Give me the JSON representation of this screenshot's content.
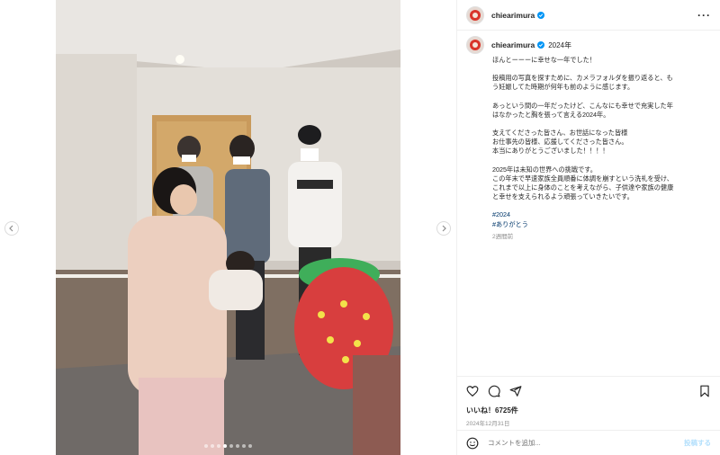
{
  "post": {
    "username": "chiearimura",
    "caption_year": "2024年",
    "caption_lines": [
      "ほんとーーーに幸せな一年でした！",
      "",
      "投稿用の写真を探すために、カメラフォルダを振り返ると、も\nう妊娠してた時期が何年も前のように感じます。",
      "",
      "あっという間の一年だったけど、こんなにも幸せで充実した年\nはなかったと胸を張って言える2024年。",
      "",
      "支えてくださった皆さん、お世話になった皆様\nお仕事先の皆様、応援してくださった皆さん。\n本当にありがとうございました！！！！",
      "",
      "2025年は未知の世界への挑戦です。\nこの年末で早速家族全員順番に体調を崩すという洗礼を受け、\nこれまで以上に身体のことを考えながら、子供達や家族の健康\nと幸せを支えられるよう頑張っていきたいです。"
    ],
    "hashtags": [
      "#2024",
      "#ありがとう"
    ],
    "time_ago": "2週間前",
    "likes": "いいね！6725件",
    "date": "2024年12月31日",
    "comment_placeholder": "コメントを追加...",
    "post_label": "投稿する",
    "carousel": {
      "count": 8,
      "active_index": 3
    }
  },
  "colors": {
    "verified": "#0095f6",
    "hashtag": "#00376b",
    "muted": "#8e8e8e",
    "post_button": "#b2dffc"
  },
  "icons": {
    "more": "more-icon",
    "like": "heart-icon",
    "comment": "comment-icon",
    "share": "share-icon",
    "save": "bookmark-icon",
    "emoji": "emoji-icon",
    "prev": "chevron-left-icon",
    "next": "chevron-right-icon"
  }
}
